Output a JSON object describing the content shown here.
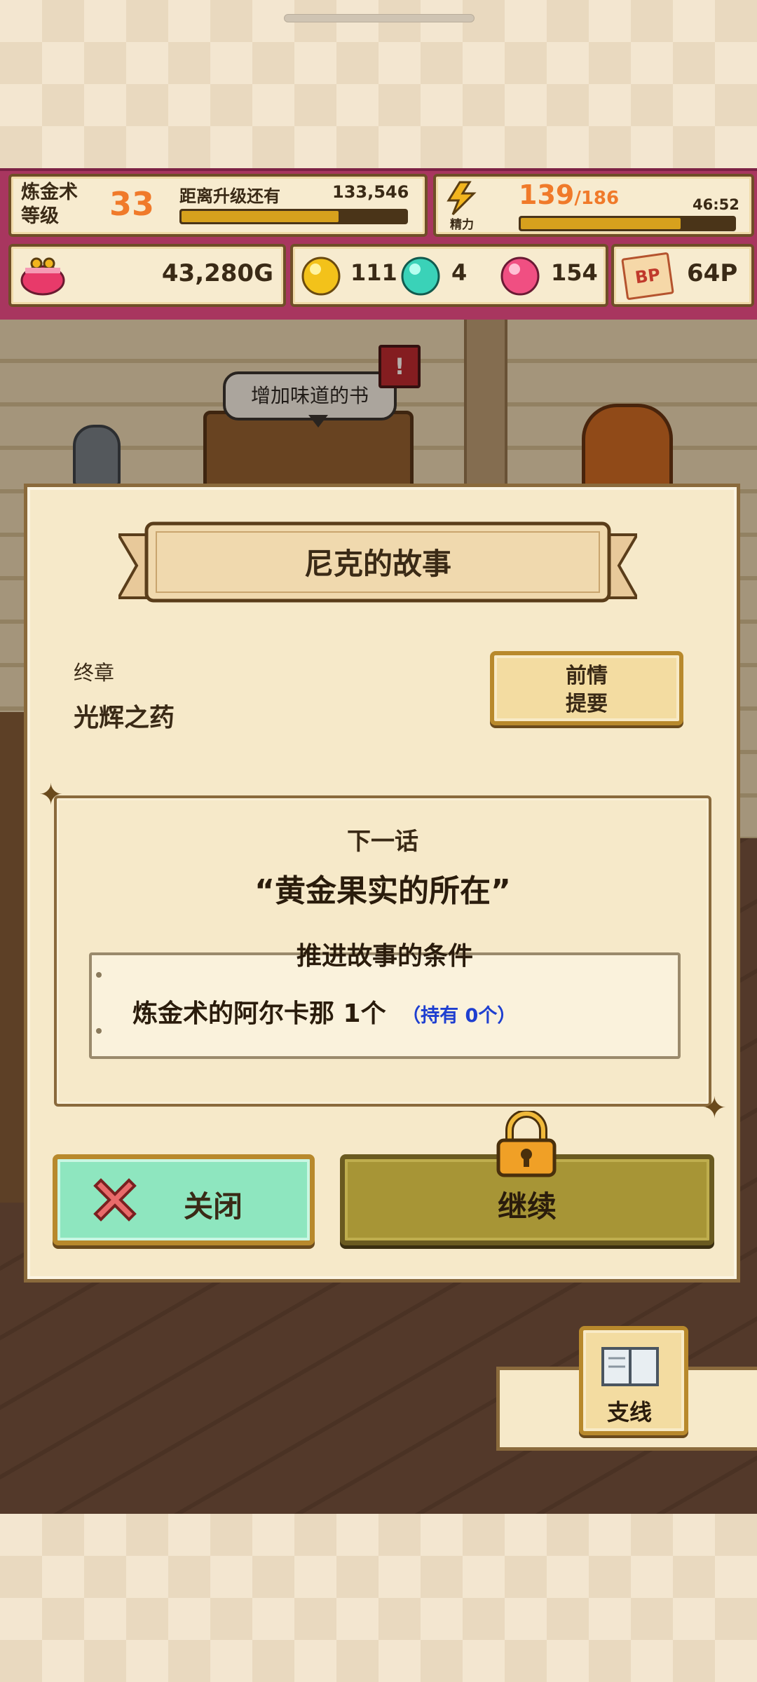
{
  "status": {
    "alchemy_label_line1": "炼金术",
    "alchemy_label_line2": "等级",
    "level": "33",
    "next_level_label": "距离升级还有",
    "exp_remaining": "133,546",
    "exp_progress": 0.7,
    "stamina_label": "精力",
    "stamina_current": "139",
    "stamina_max": "/186",
    "stamina_timer": "46:52",
    "stamina_progress": 0.75,
    "gold": "43,280G",
    "yellow_orbs": "111",
    "cyan_orbs": "4",
    "pink_orbs": "154",
    "bp_icon": "BP",
    "bp_points": "64P"
  },
  "scene": {
    "speech_bubble": "增加味道的书"
  },
  "dialog": {
    "title": "尼克的故事",
    "chapter_label": "终章",
    "chapter_name": "光辉之药",
    "summary_button_line1": "前情",
    "summary_button_line2": "提要",
    "next_label": "下一话",
    "next_title": "“黄金果实的所在”",
    "condition_label": "推进故事的条件",
    "condition_item": "炼金术的阿尔卡那 1个",
    "condition_held": "（持有 0个）",
    "close_button": "关闭",
    "continue_button": "继续"
  },
  "side": {
    "branch_button": "支线"
  },
  "colors": {
    "accent_orange": "#f07a2a",
    "magenta_frame": "#a8365f",
    "held_blue": "#1e3fd0",
    "close_green": "#8ee6bf",
    "continue_olive": "#a79536"
  }
}
